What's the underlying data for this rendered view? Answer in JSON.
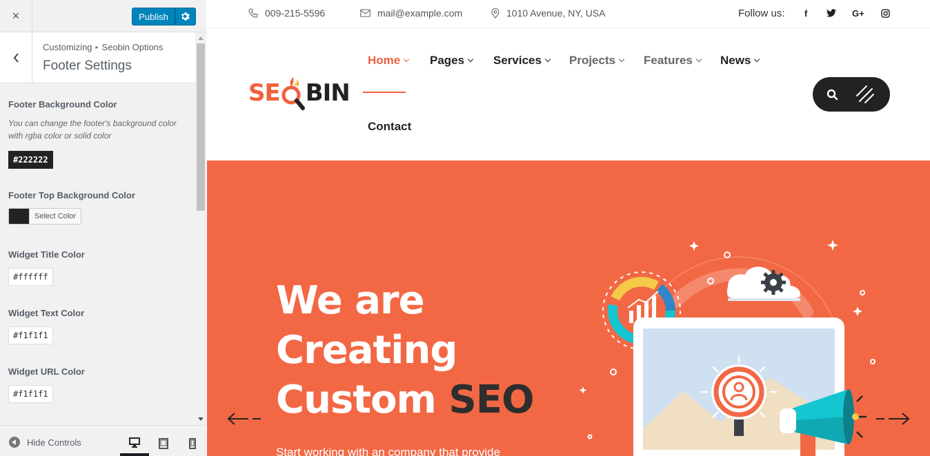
{
  "customizer": {
    "close_label": "×",
    "publish_label": "Publish",
    "breadcrumb": {
      "root": "Customizing",
      "separator": "▸",
      "parent": "Seobin Options"
    },
    "section_title": "Footer Settings",
    "controls": [
      {
        "label": "Footer Background Color",
        "description": "You can change the footer's background color with rgba color or solid color",
        "value": "#222222"
      },
      {
        "label": "Footer Top Background Color",
        "button_label": "Select Color",
        "swatch": "#222222"
      },
      {
        "label": "Widget Title Color",
        "value": "#ffffff"
      },
      {
        "label": "Widget Text Color",
        "value": "#f1f1f1"
      },
      {
        "label": "Widget URL Color",
        "value": "#f1f1f1"
      }
    ],
    "footer": {
      "hide_controls_label": "Hide Controls"
    },
    "accent": "#0085ba"
  },
  "site": {
    "topbar": {
      "phone": "009-215-5596",
      "email": "mail@example.com",
      "address": "1010 Avenue, NY, USA",
      "follow_label": "Follow us:",
      "social": [
        "f",
        "twitter",
        "G+",
        "instagram"
      ]
    },
    "logo": {
      "part1": "SE",
      "part2": "BIN"
    },
    "menu": [
      {
        "label": "Home"
      },
      {
        "label": "Pages"
      },
      {
        "label": "Services"
      },
      {
        "label": "Projects"
      },
      {
        "label": "Features"
      },
      {
        "label": "News"
      },
      {
        "label": "Contact"
      }
    ],
    "hero": {
      "line1": "We are",
      "line2": "Creating",
      "line3_light": "Custom ",
      "line3_dark": "SEO",
      "subtitle": "Start working with an company that provide",
      "background": "#f26845"
    },
    "brand_color": "#f0603e"
  }
}
